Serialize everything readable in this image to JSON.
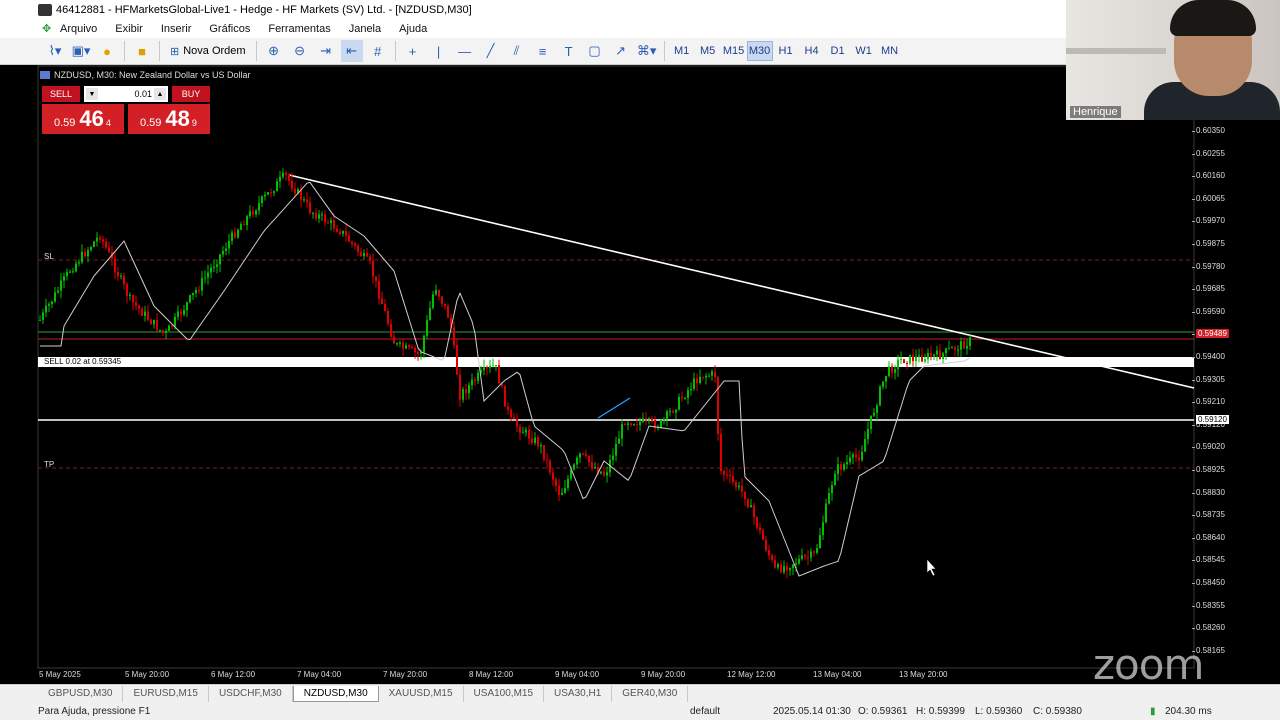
{
  "window": {
    "title": "46412881 - HFMarketsGlobal-Live1 - Hedge - HF Markets (SV) Ltd. - [NZDUSD,M30]"
  },
  "menu": [
    "Arquivo",
    "Exibir",
    "Inserir",
    "Gráficos",
    "Ferramentas",
    "Janela",
    "Ajuda"
  ],
  "toolbar": {
    "new_order_label": "Nova Ordem",
    "timeframes": [
      "M1",
      "M5",
      "M15",
      "M30",
      "H1",
      "H4",
      "D1",
      "W1",
      "MN"
    ],
    "active_timeframe": "M30"
  },
  "chart": {
    "header": "NZDUSD, M30:  New Zealand Dollar vs US Dollar",
    "trade_panel": {
      "sell_label": "SELL",
      "buy_label": "BUY",
      "lot": "0.01",
      "sell_price_small": "0.59",
      "sell_price_big": "46",
      "sell_price_sup": "4",
      "buy_price_small": "0.59",
      "buy_price_big": "48",
      "buy_price_sup": "9"
    },
    "price_labels": [
      "0.60350",
      "0.60255",
      "0.60160",
      "0.60065",
      "0.59970",
      "0.59875",
      "0.59780",
      "0.59685",
      "0.59590",
      "0.59495",
      "0.59400",
      "0.59305",
      "0.59210",
      "0.59120",
      "0.59020",
      "0.58925",
      "0.58830",
      "0.58735",
      "0.58640",
      "0.58545",
      "0.58450",
      "0.58355",
      "0.58260",
      "0.58165"
    ],
    "current_price_box": "0.59489",
    "level_box": "0.59120",
    "time_labels": [
      "5 May 2025",
      "5 May 20:00",
      "6 May 12:00",
      "7 May 04:00",
      "7 May 20:00",
      "8 May 12:00",
      "9 May 04:00",
      "9 May 20:00",
      "12 May 12:00",
      "13 May 04:00",
      "13 May 20:00"
    ],
    "sl_label": "SL",
    "tp_label": "TP",
    "order_label": "SELL 0.02 at 0.59345",
    "colors": {
      "bull": "#00c000",
      "bear": "#e00000",
      "sl_tp": "#8b1a1a",
      "trendline": "#ffffff",
      "ma": "#cfcfcf"
    }
  },
  "tabs": [
    "GBPUSD,M30",
    "EURUSD,M15",
    "USDCHF,M30",
    "NZDUSD,M30",
    "XAUUSD,M15",
    "USA100,M15",
    "USA30,H1",
    "GER40,M30"
  ],
  "active_tab": "NZDUSD,M30",
  "status": {
    "help": "Para Ajuda, pressione F1",
    "profile": "default",
    "datetime": "2025.05.14 01:30",
    "open": "O: 0.59361",
    "high": "H: 0.59399",
    "low": "L: 0.59360",
    "close": "C: 0.59380",
    "ping": "204.30 ms"
  },
  "webcam": {
    "name": "Henrique"
  },
  "watermark": "zoom"
}
